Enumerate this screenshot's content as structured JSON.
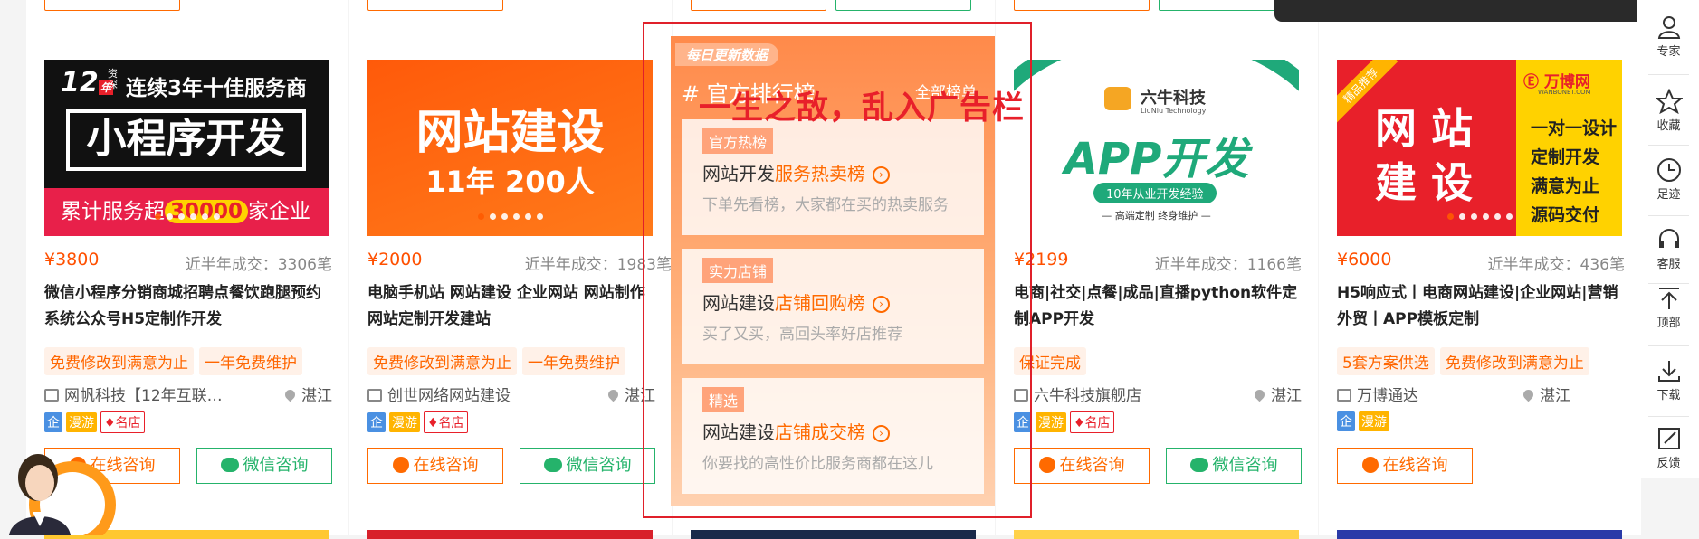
{
  "cards": [
    {
      "price": "¥3800",
      "sold": "近半年成交：3306笔",
      "title": "微信小程序分销商城招聘点餐饮跑腿预约系统公众号H5定制作开发",
      "tags": [
        "免费修改到满意为止",
        "一年免费维护"
      ],
      "shop": "网帆科技【12年互联…",
      "city": "湛江",
      "badges": [
        "企",
        "漫游",
        "名店"
      ],
      "online_label": "在线咨询",
      "wechat_label": "微信咨询",
      "banner": {
        "year": "12",
        "year_unit": "年",
        "side": "资深",
        "headline": "连续3年十佳服务商",
        "main": "小程序开发",
        "bottom_pre": "累计服务超",
        "bottom_num": "30000",
        "bottom_post": "家企业"
      }
    },
    {
      "price": "¥2000",
      "sold": "近半年成交：1983笔",
      "title": "电脑手机站 网站建设 企业网站 网站制作 网站定制开发建站",
      "tags": [
        "免费修改到满意为止",
        "一年免费维护"
      ],
      "shop": "创世网络网站建设",
      "city": "湛江",
      "badges": [
        "企",
        "漫游",
        "名店"
      ],
      "online_label": "在线咨询",
      "wechat_label": "微信咨询",
      "banner": {
        "main": "网站建设",
        "sub": "11年 200人"
      }
    },
    {
      "price": "¥2199",
      "sold": "近半年成交：1166笔",
      "title": "电商|社交|点餐|成品|直播python软件定制APP开发",
      "tags": [
        "保证完成"
      ],
      "shop": "六牛科技旗舰店",
      "city": "湛江",
      "badges": [
        "企",
        "漫游",
        "名店"
      ],
      "online_label": "在线咨询",
      "wechat_label": "微信咨询",
      "banner": {
        "brand": "六牛科技",
        "brand_en": "LiuNiu Technology",
        "main": "APP开发",
        "pill": "10年从业开发经验",
        "foot": "— 高端定制 终身维护 —"
      }
    },
    {
      "price": "¥6000",
      "sold": "近半年成交：436笔",
      "title": "H5响应式丨电商网站建设|企业网站|营销外贸丨APP模板定制",
      "tags": [
        "5套方案供选",
        "免费修改到满意为止"
      ],
      "shop": "万博通达",
      "city": "湛江",
      "badges": [
        "企",
        "漫游"
      ],
      "online_label": "在线咨询",
      "banner": {
        "ribbon": "精品推荐",
        "brand": "万博网",
        "brand_en": "WANBONET.COM",
        "main1": "网 站",
        "main2": "建 设",
        "side": [
          "一对一设计",
          "定制开发",
          "满意为止",
          "源码交付"
        ]
      }
    }
  ],
  "ranking": {
    "flag": "每日更新数据",
    "heading": "# 官方排行榜",
    "all_link": "全部榜单",
    "boxes": [
      {
        "tag": "官方热榜",
        "title": "网站开发",
        "highlight": "服务热卖榜",
        "sub": "下单先看榜，大家都在买的热卖服务"
      },
      {
        "tag": "实力店铺",
        "title": "网站建设",
        "highlight": "店铺回购榜",
        "sub": "买了又买，高回头率好店推荐"
      },
      {
        "tag": "精选",
        "title": "网站建设",
        "highlight": "店铺成交榜",
        "sub": "你要找的高性价比服务商都在这儿"
      }
    ]
  },
  "annotation": "一生之敌，乱入广告栏",
  "sidebar": [
    {
      "label": "专家",
      "icon": "expert-icon"
    },
    {
      "label": "收藏",
      "icon": "star-icon"
    },
    {
      "label": "足迹",
      "icon": "clock-icon"
    },
    {
      "label": "客服",
      "icon": "headset-icon"
    },
    {
      "label": "顶部",
      "icon": "to-top-icon"
    },
    {
      "label": "下载",
      "icon": "download-icon"
    },
    {
      "label": "反馈",
      "icon": "feedback-icon"
    }
  ],
  "colors": {
    "accent": "#ff6a00",
    "wechat": "#25b36b",
    "annotation": "#e8202a"
  }
}
